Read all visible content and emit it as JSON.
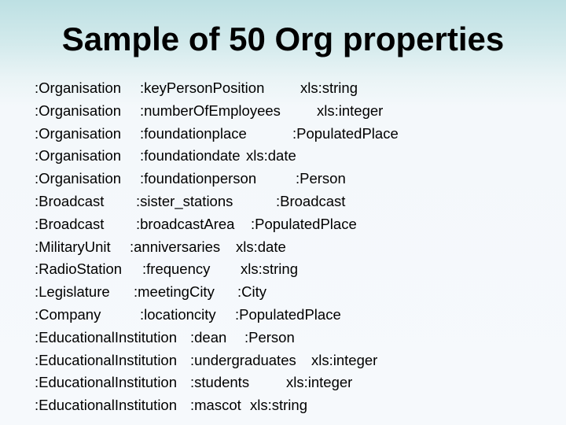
{
  "slide": {
    "title": "Sample of 50 Org properties",
    "background": {
      "top_color": "#bde0e3",
      "bottom_color": "#f6f9fc"
    },
    "rows": [
      {
        "domain": ":Organisation",
        "property": ":keyPerson.Position",
        "range": "xls:string"
      },
      {
        "domain": ":Organisation",
        "property": ":number.Of.Employees",
        "range": "xls:integer"
      },
      {
        "domain": ":Organisation",
        "property": ":foundationplace",
        "range": ":Populated.Place"
      },
      {
        "domain": ":Organisation",
        "property": ":foundationdate",
        "range": "xls:date"
      },
      {
        "domain": ":Organisation",
        "property": ":foundationperson",
        "range": ":Person"
      },
      {
        "domain": ":Broadcast",
        "property": ":sister_stations",
        "range": ":Broadcast"
      },
      {
        "domain": ":Broadcast",
        "property": ":broadcast.Area",
        "range": ":Populated.Place"
      },
      {
        "domain": ":Military.Unit",
        "property": ":anniversaries",
        "range": "xls:date"
      },
      {
        "domain": ":Radio.Station",
        "property": ":frequency",
        "range": "xls:string"
      },
      {
        "domain": ":Legislature",
        "property": ":meeting.City",
        "range": ":City"
      },
      {
        "domain": ":Company",
        "property": ":locationcity",
        "range": ":Populated.Place"
      },
      {
        "domain": ":Educational.Institution",
        "property": ":dean",
        "range": ":Person"
      },
      {
        "domain": ":Educational.Institution",
        "property": ":undergraduates",
        "range": "xls:integer"
      },
      {
        "domain": ":Educational.Institution",
        "property": ":students",
        "range": "xls:integer"
      },
      {
        "domain": ":Educational.Institution",
        "property": ":mascot",
        "range": "xls:string"
      }
    ]
  }
}
